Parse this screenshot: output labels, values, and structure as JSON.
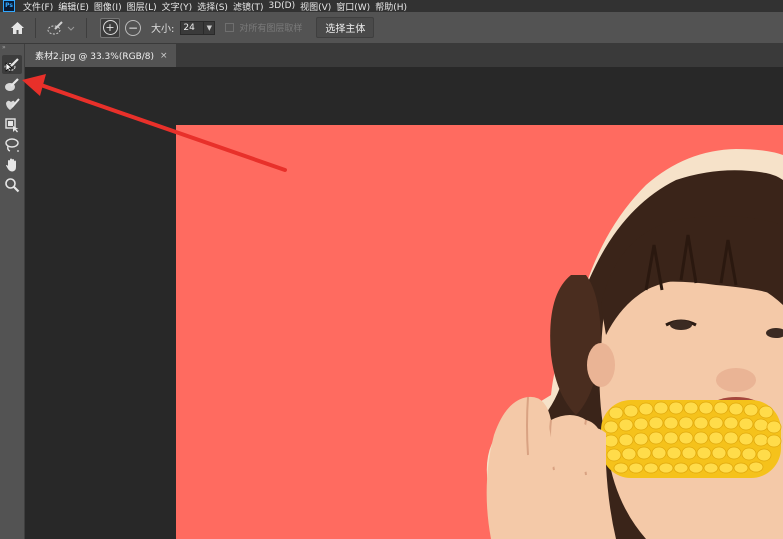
{
  "menubar": {
    "logo": "Ps",
    "items": [
      "文件(F)",
      "编辑(E)",
      "图像(I)",
      "图层(L)",
      "文字(Y)",
      "选择(S)",
      "滤镜(T)",
      "3D(D)",
      "视图(V)",
      "窗口(W)",
      "帮助(H)"
    ]
  },
  "options": {
    "size_label": "大小:",
    "size_value": "24",
    "sample_all_layers_label": "对所有图层取样",
    "select_subject_label": "选择主体"
  },
  "document_tab": {
    "title": "素材2.jpg @ 33.3%(RGB/8)",
    "close": "×"
  },
  "toolbar": {
    "handle": "»",
    "tools": [
      "quick-selection-icon",
      "brush-selection-icon",
      "healing-brush-icon",
      "object-selection-icon",
      "lasso-icon",
      "hand-icon",
      "zoom-icon"
    ]
  },
  "colors": {
    "canvas_background": "#ff6b60",
    "annotation_arrow": "#e8302a",
    "panel": "#535353"
  }
}
